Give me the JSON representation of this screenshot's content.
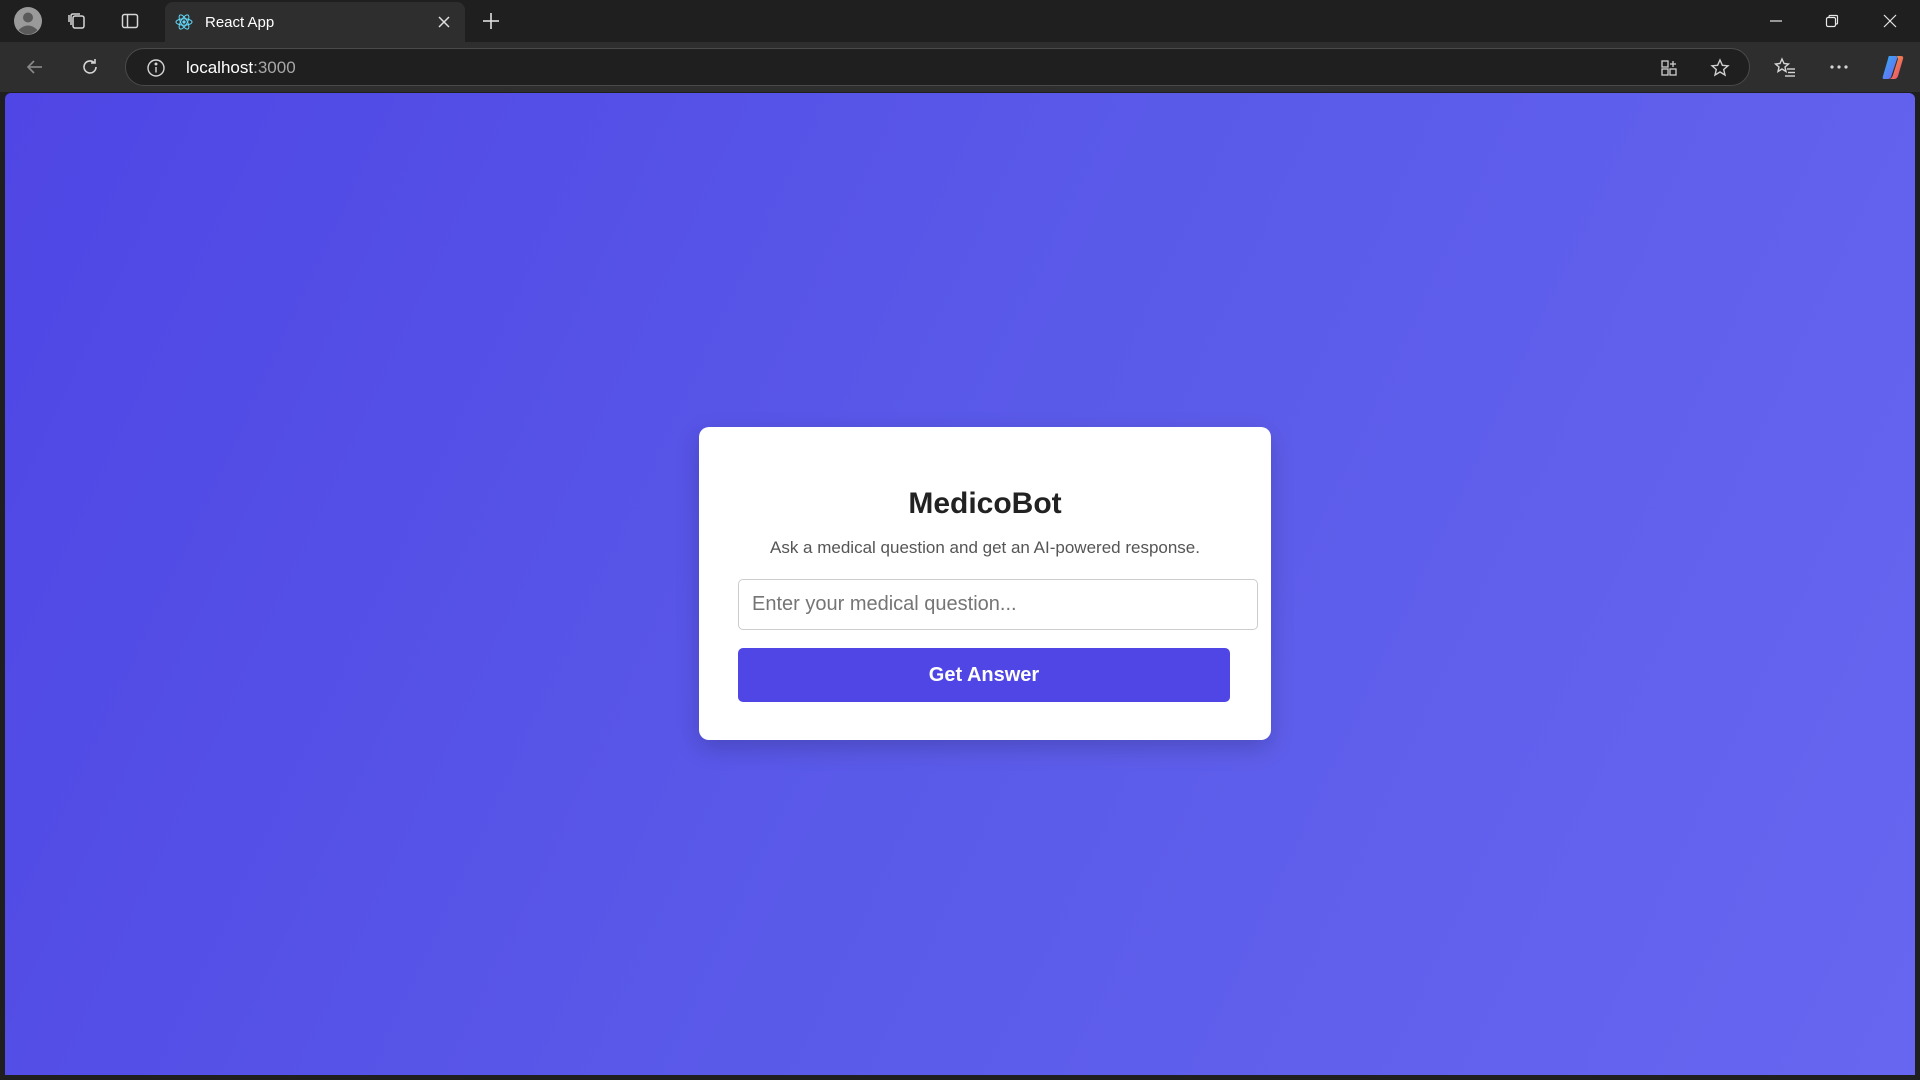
{
  "browser": {
    "tab": {
      "title": "React App",
      "favicon": "react-icon"
    },
    "address": {
      "host": "localhost",
      "port": ":3000"
    },
    "icons": {
      "profile": "profile-icon",
      "workspaces": "workspaces-icon",
      "vertical_tabs": "vertical-tabs-icon",
      "close_tab": "close-icon",
      "new_tab": "plus-icon",
      "back": "back-arrow-icon",
      "refresh": "refresh-icon",
      "site_info": "info-icon",
      "app_available": "app-available-icon",
      "favorite": "star-icon",
      "favorites": "favorites-icon",
      "more": "more-icon",
      "copilot": "copilot-icon",
      "minimize": "minimize-icon",
      "restore": "restore-icon",
      "close_window": "close-window-icon"
    }
  },
  "app": {
    "title": "MedicoBot",
    "subtitle": "Ask a medical question and get an AI-powered response.",
    "input_placeholder": "Enter your medical question...",
    "input_value": "",
    "button_label": "Get Answer",
    "colors": {
      "background_start": "#4f46e5",
      "background_end": "#6666f1",
      "button": "#4f46e5",
      "card": "#ffffff"
    }
  }
}
